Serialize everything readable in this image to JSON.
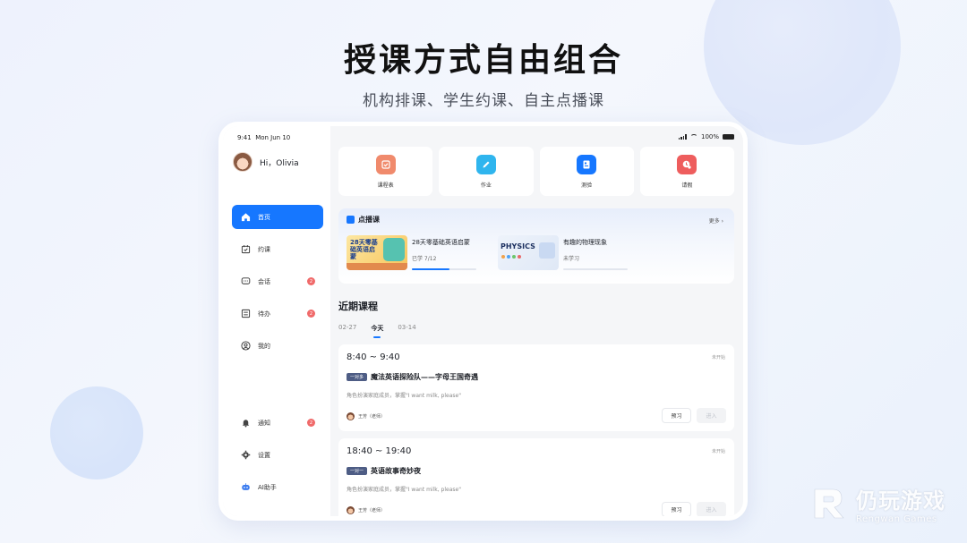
{
  "hero": {
    "title": "授课方式自由组合",
    "subtitle": "机构排课、学生约课、自主点播课"
  },
  "status_bar": {
    "time": "9:41",
    "date": "Mon Jun 10",
    "battery": "100%"
  },
  "user": {
    "greeting": "Hi，Olivia"
  },
  "nav": {
    "items": [
      {
        "label": "首页",
        "icon": "home-icon",
        "active": true
      },
      {
        "label": "约课",
        "icon": "calendar-icon"
      },
      {
        "label": "会话",
        "icon": "chat-icon",
        "badge": "2"
      },
      {
        "label": "待办",
        "icon": "todo-icon",
        "badge": "2"
      },
      {
        "label": "我的",
        "icon": "profile-icon"
      }
    ],
    "bottom": [
      {
        "label": "通知",
        "icon": "bell-icon",
        "badge": "2"
      },
      {
        "label": "设置",
        "icon": "gear-icon"
      },
      {
        "label": "AI助手",
        "icon": "robot-icon"
      }
    ]
  },
  "quick_actions": [
    {
      "label": "课程表",
      "icon": "schedule-icon",
      "color": "#f08a6c"
    },
    {
      "label": "作业",
      "icon": "pencil-icon",
      "color": "#2fb5ee"
    },
    {
      "label": "测验",
      "icon": "quiz-icon",
      "color": "#1677ff"
    },
    {
      "label": "请假",
      "icon": "leave-icon",
      "color": "#ee5d5d"
    }
  ],
  "vod": {
    "title": "点播课",
    "more": "更多 ›",
    "items": [
      {
        "title": "28天零基础英语启蒙",
        "progress_text": "已学 7/12",
        "progress": 0.58,
        "thumb_text": "28天零基础英语启蒙"
      },
      {
        "title": "有趣的物理现象",
        "progress_text": "未学习",
        "progress": 0,
        "thumb_text": "PHYSICS"
      }
    ]
  },
  "recent": {
    "title": "近期课程",
    "tabs": [
      {
        "label": "02-27"
      },
      {
        "label": "今天",
        "active": true
      },
      {
        "label": "03-14"
      }
    ],
    "courses": [
      {
        "time": "8:40 ~ 9:40",
        "status": "未开始",
        "tag": "一对多",
        "title": "魔法英语探险队——字母王国奇遇",
        "desc": "角色扮演家庭成员，掌握\"I want milk, please\"",
        "teacher": "王芳（老师）",
        "preview": "预习",
        "enter": "进入"
      },
      {
        "time": "18:40 ~ 19:40",
        "status": "未开始",
        "tag": "一对一",
        "title": "英语故事奇妙夜",
        "desc": "角色扮演家庭成员，掌握\"I want milk, please\"",
        "teacher": "王芳（老师）",
        "preview": "预习",
        "enter": "进入"
      }
    ]
  },
  "watermark": {
    "cn": "仍玩游戏",
    "en": "Rengwan Games"
  },
  "colors": {
    "accent": "#1677ff",
    "badge": "#f06a6a"
  }
}
